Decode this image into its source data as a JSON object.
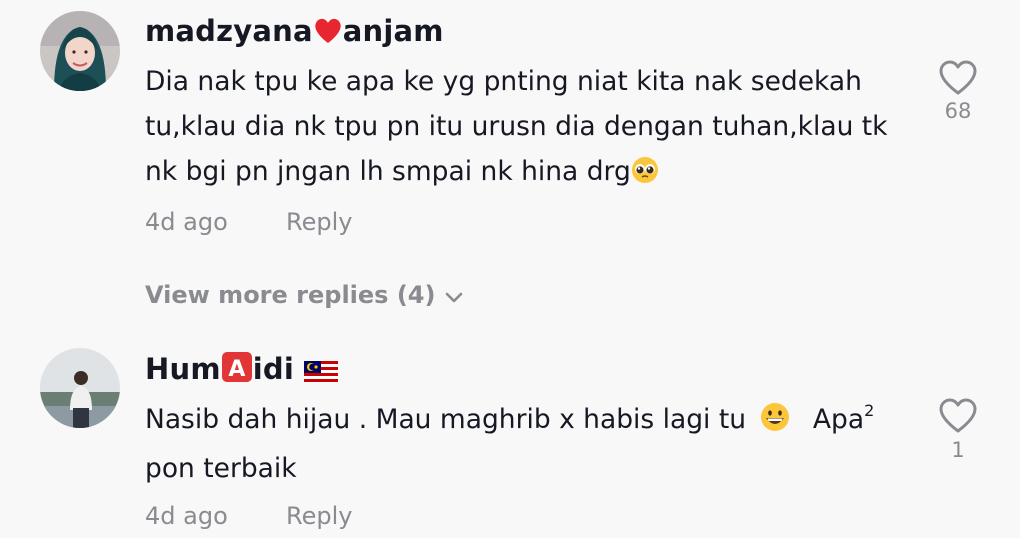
{
  "comments": [
    {
      "username_pre": "madzyana",
      "username_post": "anjam",
      "text": "Dia nak tpu ke apa ke yg pnting niat kita nak sedekah tu,klau dia nk tpu pn itu urusn dia dengan tuhan,klau tk nk bgi pn jngan lh smpai nk hina drg",
      "time": "4d ago",
      "reply_label": "Reply",
      "likes": "68"
    },
    {
      "username_pre": "Hum",
      "username_badge": "A",
      "username_post": "idi",
      "text_a": "Nasib dah hijau . Mau maghrib x habis lagi tu",
      "text_b": "Apa",
      "text_sup": "2",
      "text_c": "pon terbaik",
      "time": "4d ago",
      "reply_label": "Reply",
      "likes": "1"
    }
  ],
  "view_more_replies": "View more replies (4)",
  "icons": {
    "heart": "heart-outline-icon",
    "chevron": "chevron-down-icon",
    "red_heart": "red-heart-emoji",
    "badge": "letter-a-badge-emoji",
    "flag": "malaysia-flag-emoji",
    "pleading": "pleading-face-emoji",
    "grin": "grinning-face-emoji"
  },
  "colors": {
    "text": "#161823",
    "muted": "#8a8b91",
    "background": "#f8f8f8"
  }
}
